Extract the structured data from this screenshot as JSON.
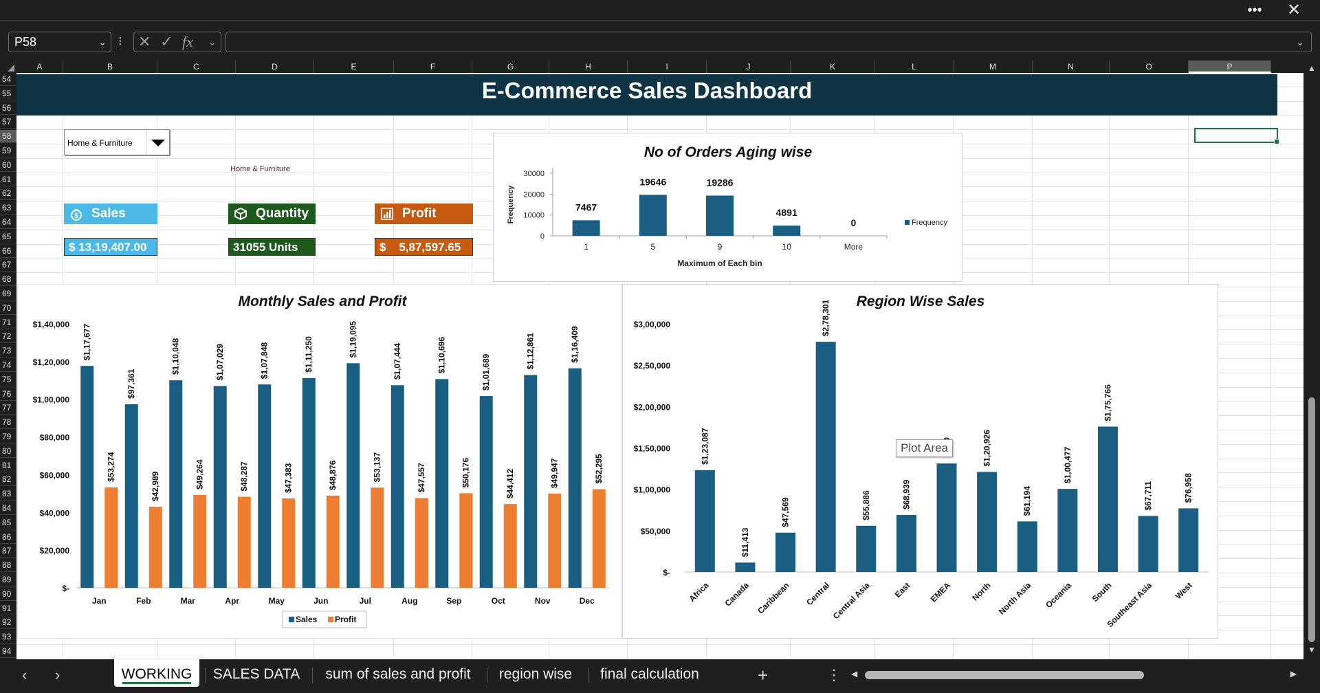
{
  "window": {
    "more_icon": "ellipsis-icon",
    "close_icon": "close-icon"
  },
  "formula_bar": {
    "name_box": "P58",
    "formula": "",
    "icons": [
      "cancel-icon",
      "confirm-icon",
      "function-icon"
    ]
  },
  "columns": [
    "A",
    "B",
    "C",
    "D",
    "E",
    "F",
    "G",
    "H",
    "I",
    "J",
    "K",
    "L",
    "M",
    "N",
    "O",
    "P"
  ],
  "selected_column": "P",
  "rows": [
    "54",
    "55",
    "56",
    "57",
    "58",
    "59",
    "60",
    "61",
    "62",
    "63",
    "64",
    "65",
    "66",
    "67",
    "68",
    "69",
    "70",
    "71",
    "72",
    "73",
    "74",
    "75",
    "76",
    "77",
    "78",
    "79",
    "80",
    "81",
    "82",
    "83",
    "84",
    "85",
    "86",
    "87",
    "88",
    "89",
    "90",
    "91",
    "92",
    "93",
    "94"
  ],
  "selected_row": "58",
  "dashboard": {
    "title": "E-Commerce Sales Dashboard",
    "category_dropdown": "Home & Furniture",
    "selected_category": "Home & Furniture",
    "kpis": {
      "sales": {
        "label": "Sales",
        "value": "$ 13,19,407.00",
        "color": "#4cb8e6",
        "icon": "money-bag-icon"
      },
      "quantity": {
        "label": "Quantity",
        "value": "31055 Units",
        "color": "#1e5a1e",
        "icon": "box-icon"
      },
      "profit": {
        "label": "Profit",
        "value": "$    5,87,597.65",
        "color": "#c55a11",
        "icon": "bar-chart-icon"
      }
    },
    "tooltip": "Plot Area"
  },
  "colors": {
    "sales": "#1a5f82",
    "profit": "#ed7d31",
    "banner": "#0f3446",
    "aging_bar": "#1a5f82"
  },
  "chart_data": [
    {
      "type": "bar",
      "title": "No of Orders Aging wise",
      "xlabel": "Maximum of Each bin",
      "ylabel": "Frequency",
      "categories": [
        "1",
        "5",
        "9",
        "10",
        "More"
      ],
      "series": [
        {
          "name": "Frequency",
          "values": [
            7467,
            19646,
            19286,
            4891,
            0
          ]
        }
      ],
      "y_ticks": [
        "0",
        "10000",
        "20000",
        "30000"
      ],
      "ylim": [
        0,
        30000
      ],
      "legend": "right"
    },
    {
      "type": "bar",
      "title": "Monthly Sales and Profit",
      "categories": [
        "Jan",
        "Feb",
        "Mar",
        "Apr",
        "May",
        "Jun",
        "Jul",
        "Aug",
        "Sep",
        "Oct",
        "Nov",
        "Dec"
      ],
      "series": [
        {
          "name": "Sales",
          "values": [
            117677,
            97361,
            110048,
            107029,
            107848,
            111250,
            119095,
            107444,
            110696,
            101689,
            112861,
            116409
          ],
          "labels": [
            "$1,17,677",
            "$97,361",
            "$1,10,048",
            "$1,07,029",
            "$1,07,848",
            "$1,11,250",
            "$1,19,095",
            "$1,07,444",
            "$1,10,696",
            "$1,01,689",
            "$1,12,861",
            "$1,16,409"
          ]
        },
        {
          "name": "Profit",
          "values": [
            53274,
            42989,
            49264,
            48287,
            47383,
            48876,
            53137,
            47557,
            50176,
            44412,
            49947,
            52295
          ],
          "labels": [
            "$53,274",
            "$42,989",
            "$49,264",
            "$48,287",
            "$47,383",
            "$48,876",
            "$53,137",
            "$47,557",
            "$50,176",
            "$44,412",
            "$49,947",
            "$52,295"
          ]
        }
      ],
      "y_ticks": [
        "$-",
        "$20,000",
        "$40,000",
        "$60,000",
        "$80,000",
        "$1,00,000",
        "$1,20,000",
        "$1,40,000"
      ],
      "ylim": [
        0,
        140000
      ],
      "legend": "bottom"
    },
    {
      "type": "bar",
      "title": "Region Wise Sales",
      "categories": [
        "Africa",
        "Canada",
        "Caribbean",
        "Central",
        "Central Asia",
        "East",
        "EMEA",
        "North",
        "North Asia",
        "Oceania",
        "South",
        "Southeast Asia",
        "West"
      ],
      "series": [
        {
          "name": "Sales",
          "values": [
            123087,
            11413,
            47569,
            278301,
            55886,
            68939,
            131180,
            120926,
            61194,
            100477,
            175766,
            67711,
            76958
          ],
          "labels": [
            "$1,23,087",
            "$11,413",
            "$47,569",
            "$2,78,301",
            "$55,886",
            "$68,939",
            "1,180",
            "$1,20,926",
            "$61,194",
            "$1,00,477",
            "$1,75,766",
            "$67,711",
            "$76,958"
          ]
        }
      ],
      "y_ticks": [
        "$-",
        "$50,000",
        "$1,00,000",
        "$1,50,000",
        "$2,00,000",
        "$2,50,000",
        "$3,00,000"
      ],
      "ylim": [
        0,
        300000
      ],
      "legend": "none"
    }
  ],
  "sheet_tabs": [
    {
      "label": "WORKING",
      "active": true
    },
    {
      "label": "SALES DATA",
      "active": false
    },
    {
      "label": "sum of sales and profit",
      "active": false
    },
    {
      "label": "region wise",
      "active": false
    },
    {
      "label": "final calculation",
      "active": false
    }
  ],
  "tabbar_icons": {
    "prev": "chevron-left-icon",
    "next": "chevron-right-icon",
    "add": "plus-icon",
    "more": "vertical-ellipsis-icon"
  }
}
